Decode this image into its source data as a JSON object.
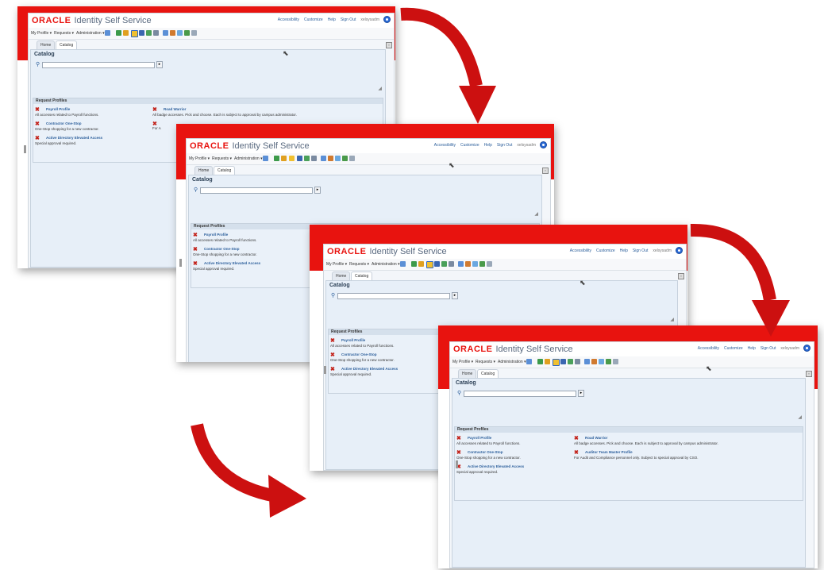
{
  "app": {
    "logo": "ORACLE",
    "title": "Identity Self Service"
  },
  "top_links": [
    "Accessibility",
    "Customize",
    "Help",
    "Sign Out",
    "xelsysadm"
  ],
  "menu": {
    "my_profile": "My Profile ▾",
    "requests": "Requests ▾",
    "administration": "Administration ▾"
  },
  "tabs": {
    "home": "Home",
    "catalog": "Catalog"
  },
  "catalog": {
    "title": "Catalog",
    "search_value": ""
  },
  "request_profiles": {
    "header": "Request Profiles",
    "items": [
      {
        "name": "Payroll Profile",
        "desc": "All accesses related to Payroll functions."
      },
      {
        "name": "Contractor One-Stop",
        "desc": "One-Stop shopping for a new contractor."
      },
      {
        "name": "Active Directory Elevated Access",
        "desc": "Special approval required."
      },
      {
        "name": "Road Warrior",
        "desc": "All badge accesses. Pick and choose. Each is subject to approval by campus administrator."
      },
      {
        "name": "Auditor Team Master Profile",
        "desc": "For Audit and Compliance personnel only. Subject to special approval by CSO."
      }
    ]
  },
  "colors": {
    "oracle_red": "#e8130f",
    "arrow_red": "#cc1010",
    "link_blue": "#2a5d9a"
  }
}
